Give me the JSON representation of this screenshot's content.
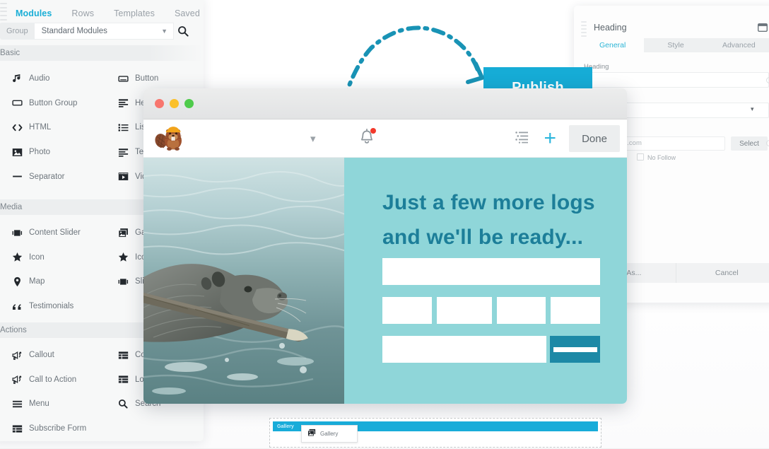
{
  "sidebar": {
    "tabs": [
      {
        "label": "Modules",
        "active": true
      },
      {
        "label": "Rows",
        "active": false
      },
      {
        "label": "Templates",
        "active": false
      },
      {
        "label": "Saved",
        "active": false
      }
    ],
    "group_button_label": "Group",
    "group_value": "Standard Modules",
    "search_icon": "search-icon",
    "sections": [
      {
        "title": "Basic",
        "items": [
          {
            "label": "Audio",
            "icon": "audio-note-icon"
          },
          {
            "label": "Button",
            "icon": "button-icon"
          },
          {
            "label": "Button Group",
            "icon": "button-group-icon"
          },
          {
            "label": "Heading",
            "icon": "heading-icon"
          },
          {
            "label": "HTML",
            "icon": "code-icon"
          },
          {
            "label": "List",
            "icon": "list-icon"
          },
          {
            "label": "Photo",
            "icon": "photo-icon"
          },
          {
            "label": "Text",
            "icon": "text-icon"
          },
          {
            "label": "Separator",
            "icon": "separator-icon"
          },
          {
            "label": "Video",
            "icon": "video-icon"
          }
        ]
      },
      {
        "title": "Media",
        "items": [
          {
            "label": "Content Slider",
            "icon": "slider-icon"
          },
          {
            "label": "Gallery",
            "icon": "gallery-icon"
          },
          {
            "label": "Icon",
            "icon": "star-icon"
          },
          {
            "label": "Icon",
            "icon": "star-icon"
          },
          {
            "label": "Map",
            "icon": "map-pin-icon"
          },
          {
            "label": "Slideshow",
            "icon": "slider-icon"
          },
          {
            "label": "Testimonials",
            "icon": "quote-icon"
          },
          {
            "label": "",
            "icon": ""
          }
        ]
      },
      {
        "title": "Actions",
        "items": [
          {
            "label": "Callout",
            "icon": "megaphone-icon"
          },
          {
            "label": "Contact Form",
            "icon": "form-icon"
          },
          {
            "label": "Call to Action",
            "icon": "megaphone-icon"
          },
          {
            "label": "Login Form",
            "icon": "form-icon"
          },
          {
            "label": "Menu",
            "icon": "hamburger-icon"
          },
          {
            "label": "Search",
            "icon": "search-icon"
          },
          {
            "label": "Subscribe Form",
            "icon": "form-icon"
          },
          {
            "label": "",
            "icon": ""
          }
        ]
      }
    ]
  },
  "settings_panel": {
    "title": "Heading",
    "window_icon": "window-icon",
    "tabs": [
      {
        "label": "General",
        "active": true
      },
      {
        "label": "Style",
        "active": false
      },
      {
        "label": "Advanced",
        "active": false
      }
    ],
    "field_label": "Heading",
    "heading_value": "",
    "tag_value": "",
    "link_value": "e.com",
    "select_button_label": "Select",
    "nofollow_label": "No Follow",
    "footer": {
      "save_as_label": "Save As...",
      "cancel_label": "Cancel"
    }
  },
  "publish": {
    "label": "Publish",
    "color": "#16ACD6"
  },
  "arrow": {
    "name": "dashed-curved-arrow",
    "color": "#1993b5",
    "style": "dash-dot"
  },
  "browser": {
    "traffic_lights": [
      "close-red",
      "minimize-yellow",
      "maximize-green"
    ],
    "toolbar": {
      "logo": "beaver-builder-mascot-icon",
      "chevron": "chevron-down-icon",
      "bell": "notification-bell-icon",
      "bell_badge": true,
      "outline": "outline-list-icon",
      "plus": "add-plus-icon",
      "done_label": "Done"
    },
    "content": {
      "photo_alt": "beaver-swimming-with-stick-photo",
      "headline_line1": "Just a few more logs",
      "headline_line2": "and we'll be ready...",
      "headline_color": "#1c7e99",
      "panel_color": "#8fd6d9",
      "submit_color": "#1d89a6",
      "fields": {
        "full_width_top": "",
        "row_of_four": [
          "",
          "",
          "",
          ""
        ],
        "bottom_input": "",
        "submit_label": ""
      }
    }
  },
  "gallery_row": {
    "bar_label": "Gallery",
    "popup_label": "Gallery",
    "popup_icon": "gallery-icon",
    "bar_color": "#18ACD9"
  }
}
